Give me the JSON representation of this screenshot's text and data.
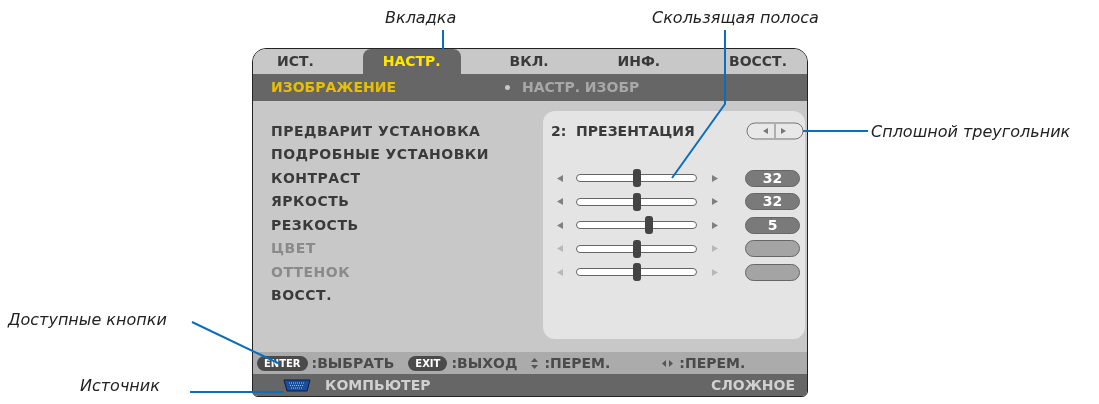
{
  "callouts": [
    {
      "kind": "tab",
      "label": "Вкладка"
    },
    {
      "kind": "slider",
      "label": "Скользящая полоса"
    },
    {
      "kind": "triangle",
      "label": "Сплошной треугольник"
    },
    {
      "kind": "buttons",
      "label": "Доступные кнопки"
    },
    {
      "kind": "source",
      "label": "Источник"
    }
  ],
  "tabs": [
    {
      "label": "ИСТ.",
      "selected": false
    },
    {
      "label": "НАСТР.",
      "selected": true
    },
    {
      "label": "ВКЛ.",
      "selected": false
    },
    {
      "label": "ИНФ.",
      "selected": false
    },
    {
      "label": "ВОССТ.",
      "selected": false
    }
  ],
  "subheader": {
    "title": "ИЗОБРАЖЕНИЕ",
    "item": "НАСТР. ИЗОБР"
  },
  "rows": [
    {
      "kind": "select",
      "label": "ПРЕДВАРИТ УСТАНОВКА",
      "value": "2:  ПРЕЗЕНТАЦИЯ",
      "disabled": false
    },
    {
      "kind": "label",
      "label": "ПОДРОБНЫЕ УСТАНОВКИ",
      "disabled": false
    },
    {
      "kind": "slider",
      "label": "КОНТРАСТ",
      "level": 0.5,
      "reading": "32",
      "disabled": false
    },
    {
      "kind": "slider",
      "label": "ЯРКОСТЬ",
      "level": 0.5,
      "reading": "32",
      "disabled": false
    },
    {
      "kind": "slider",
      "label": "РЕЗКОСТЬ",
      "level": 0.6,
      "reading": "5",
      "disabled": false
    },
    {
      "kind": "slider",
      "label": "ЦВЕТ",
      "level": 0.5,
      "disabled": true
    },
    {
      "kind": "slider",
      "label": "ОТТЕНОК",
      "level": 0.5,
      "disabled": true
    },
    {
      "kind": "label",
      "label": "ВОССТ.",
      "disabled": false
    }
  ],
  "hints": [
    {
      "kind": "key",
      "key": "ENTER",
      "text": ":ВЫБРАТЬ"
    },
    {
      "kind": "key",
      "key": "EXIT",
      "text": ":ВЫХОД"
    },
    {
      "kind": "updown",
      "text": ":ПЕРЕМ."
    },
    {
      "kind": "leftright",
      "text": ":ПЕРЕМ."
    }
  ],
  "source": {
    "name": "КОМПЬЮТЕР",
    "mode": "СЛОЖНОЕ"
  }
}
